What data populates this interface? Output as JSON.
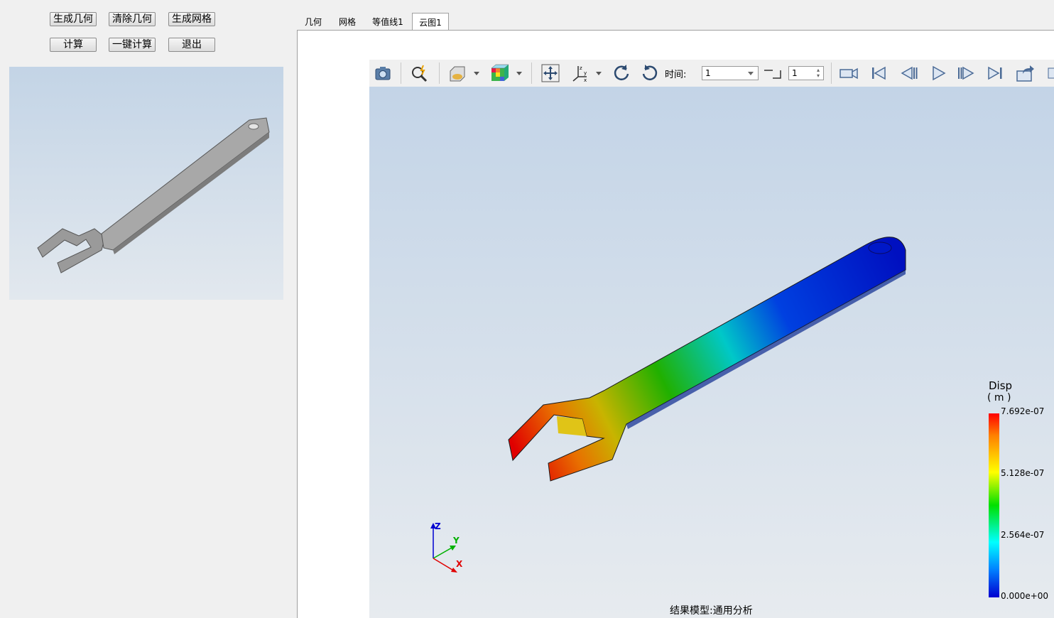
{
  "buttons": {
    "gen_geometry": "生成几何",
    "clear_geometry": "清除几何",
    "gen_mesh": "生成网格",
    "compute": "计算",
    "one_click_compute": "一键计算",
    "exit": "退出"
  },
  "tabs": [
    "几何",
    "网格",
    "等值线1",
    "云图1"
  ],
  "active_tab": "云图1",
  "toolbar": {
    "time_label": "时间:",
    "time_value": "1",
    "step_value": "1",
    "icons": [
      "camera-icon",
      "zoom-icon",
      "display-mode-icon",
      "color-cube-icon",
      "fit-view-icon",
      "axis-view-icon",
      "rotate-left-icon",
      "rotate-right-icon",
      "video-record-icon",
      "first-frame-icon",
      "previous-frame-icon",
      "play-icon",
      "next-frame-icon",
      "last-frame-icon",
      "export-icon"
    ]
  },
  "legend": {
    "title": "Disp",
    "unit": "( m )",
    "ticks": [
      "7.692e-07",
      "5.128e-07",
      "2.564e-07",
      "0.000e+00"
    ],
    "colors": [
      "#ff0000",
      "#ffff00",
      "#00e000",
      "#00ffff",
      "#0000d0"
    ]
  },
  "axis_labels": {
    "x": "X",
    "y": "Y",
    "z": "Z"
  },
  "status": "结果模型:通用分析"
}
